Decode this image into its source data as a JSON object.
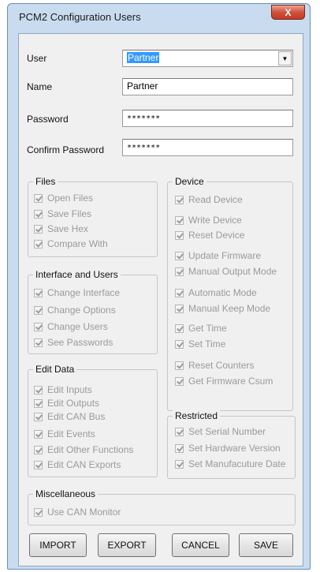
{
  "window": {
    "title": "PCM2 Configuration Users",
    "close_glyph": "X"
  },
  "form": {
    "user_label": "User",
    "user_value": "Partner",
    "name_label": "Name",
    "name_value": "Partner",
    "password_label": "Password",
    "password_value": "*******",
    "confirm_label": "Confirm Password",
    "confirm_value": "*******"
  },
  "groups": {
    "files": {
      "title": "Files",
      "items": [
        "Open Files",
        "Save Files",
        "Save Hex",
        "Compare With"
      ]
    },
    "interface": {
      "title": "Interface and Users",
      "items": [
        "Change Interface",
        "Change Options",
        "Change Users",
        "See Passwords"
      ]
    },
    "edit": {
      "title": "Edit Data",
      "items": [
        "Edit Inputs",
        "Edit Outputs",
        "Edit CAN Bus",
        "Edit Events",
        "Edit Other Functions",
        "Edit CAN Exports"
      ]
    },
    "device": {
      "title": "Device",
      "items": [
        "Read Device",
        "Write Device",
        "Reset Device",
        "Update Firmware",
        "Manual Output Mode",
        "Automatic Mode",
        "Manual Keep Mode",
        "Get Time",
        "Set Time",
        "Reset Counters",
        "Get Firmware Csum"
      ]
    },
    "restricted": {
      "title": "Restricted",
      "items": [
        "Set Serial Number",
        "Set Hardware Version",
        "Set Manufacuture Date"
      ]
    },
    "misc": {
      "title": "Miscellaneous",
      "items": [
        "Use CAN Monitor"
      ]
    }
  },
  "buttons": {
    "import": "IMPORT",
    "export": "EXPORT",
    "cancel": "CANCEL",
    "save": "SAVE"
  },
  "checkbox_state": "checked-disabled",
  "icons": {
    "checkbox": "checkmark-icon",
    "dropdown": "chevron-down-icon",
    "close": "close-icon"
  }
}
